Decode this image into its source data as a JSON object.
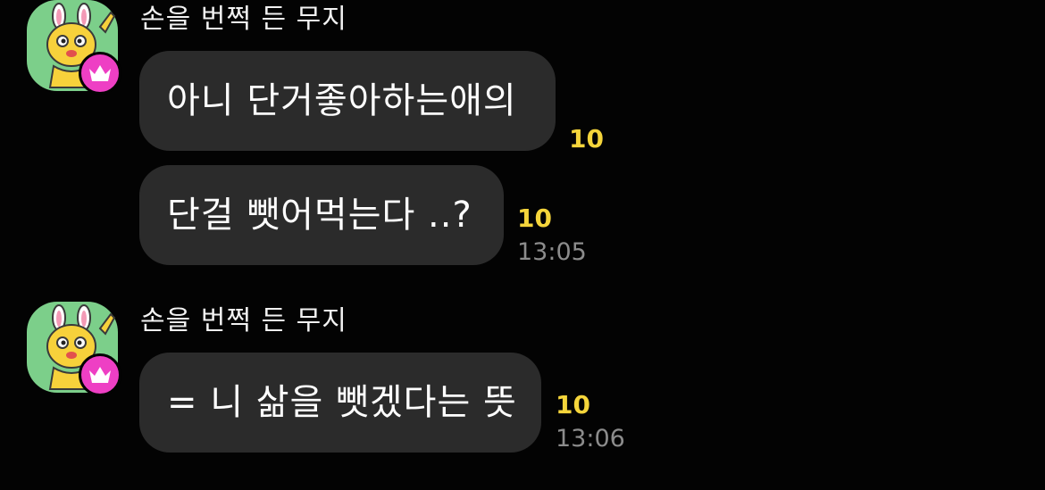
{
  "messages": [
    {
      "sender": "손을 번쩍 든 무지",
      "avatar_icon": "muzi-raising-hand-icon",
      "badge_icon": "crown-icon",
      "bubbles": [
        {
          "text": "아니 단거좋아하는애의",
          "unread": "10",
          "time": ""
        },
        {
          "text": "단걸 뺏어먹는다 ..?",
          "unread": "10",
          "time": "13:05"
        }
      ]
    },
    {
      "sender": "손을 번쩍 든 무지",
      "avatar_icon": "muzi-raising-hand-icon",
      "badge_icon": "crown-icon",
      "bubbles": [
        {
          "text": "= 니 삶을 뺏겠다는 뜻",
          "unread": "10",
          "time": "13:06"
        }
      ]
    }
  ],
  "colors": {
    "background": "#030303",
    "bubble": "#2b2b2b",
    "unread": "#f5d53b",
    "time": "#8c8c8c",
    "avatar_bg": "#7ccf8a",
    "badge": "#ee3fc4"
  }
}
